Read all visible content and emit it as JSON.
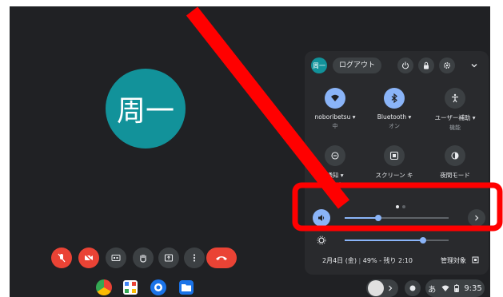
{
  "user": {
    "display_name": "周一",
    "chip_label": "周一"
  },
  "header": {
    "logout_label": "ログアウト",
    "power_icon": "power-icon",
    "lock_icon": "lock-icon",
    "settings_icon": "gear-icon",
    "collapse_icon": "chevron-down-icon"
  },
  "features": [
    {
      "label": "noboribetsu ▾",
      "sub": "中",
      "icon": "wifi-icon",
      "state": "on"
    },
    {
      "label": "Bluetooth ▾",
      "sub": "オン",
      "icon": "bluetooth-icon",
      "state": "on"
    },
    {
      "label": "ユーザー補助 ▾",
      "sub": "機能",
      "icon": "accessibility-icon",
      "state": "off"
    },
    {
      "label": "通知 ▾",
      "sub": "全アプリ",
      "icon": "notifications-icon",
      "state": "off"
    },
    {
      "label": "スクリーン キ",
      "sub": "",
      "icon": "screen-capture-icon",
      "state": "off"
    },
    {
      "label": "夜間モード",
      "sub": "",
      "icon": "night-light-icon",
      "state": "off"
    }
  ],
  "sliders": {
    "volume_level": 0.32,
    "brightness_level": 0.75
  },
  "footer": {
    "date": "2月4日 (金)",
    "battery": "49% - 残り 2:10",
    "managed": "管理対象"
  },
  "shelf": {
    "ime": "あ",
    "time": "9:35"
  },
  "colors": {
    "accent": "#8ab4f8",
    "danger": "#ea4335",
    "avatar": "#12929a",
    "annotation": "#ff0000"
  }
}
